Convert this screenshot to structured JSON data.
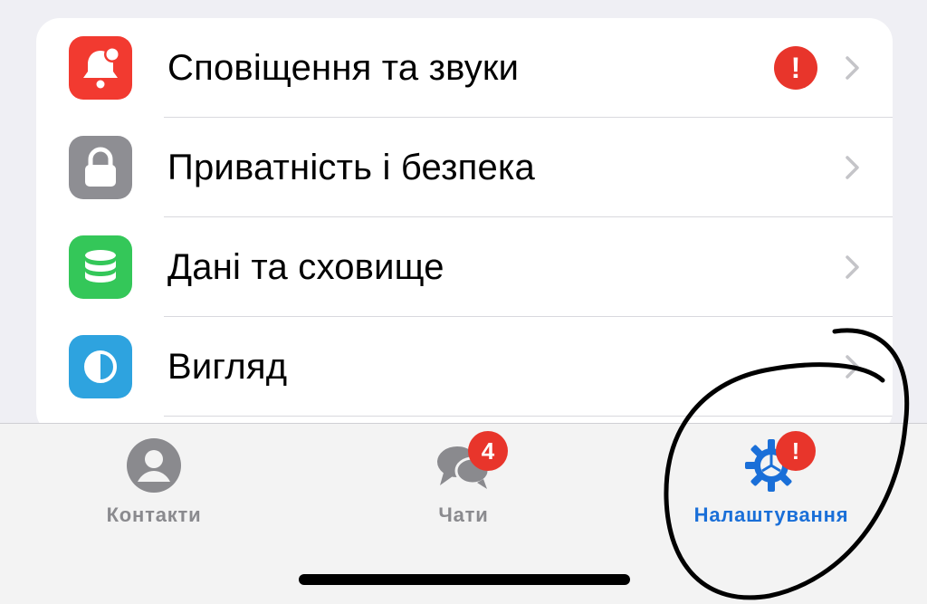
{
  "settings_list": {
    "items": [
      {
        "label": "Сповіщення та звуки",
        "icon": "bell-icon",
        "icon_color": "#f23a30",
        "has_alert": true,
        "alert_text": "!"
      },
      {
        "label": "Приватність і безпека",
        "icon": "lock-icon",
        "icon_color": "#8e8e93",
        "has_alert": false
      },
      {
        "label": "Дані та сховище",
        "icon": "database-icon",
        "icon_color": "#34c759",
        "has_alert": false
      },
      {
        "label": "Вигляд",
        "icon": "appearance-icon",
        "icon_color": "#2ea3df",
        "has_alert": false
      }
    ],
    "chevron_icon": "chevron-right-icon",
    "alert_color": "#e8352b"
  },
  "tab_bar": {
    "tabs": [
      {
        "label": "Контакти",
        "icon": "person-circle-icon",
        "active": false
      },
      {
        "label": "Чати",
        "icon": "chat-bubbles-icon",
        "active": false,
        "badge": "4"
      },
      {
        "label": "Налаштування",
        "icon": "gear-icon",
        "active": true,
        "badge": "!"
      }
    ],
    "active_color": "#1a6fd8",
    "inactive_color": "#8a8a8e",
    "badge_color": "#e8352b"
  },
  "annotation": {
    "shape": "hand-drawn circle",
    "target": "Налаштування",
    "color": "#000000"
  }
}
